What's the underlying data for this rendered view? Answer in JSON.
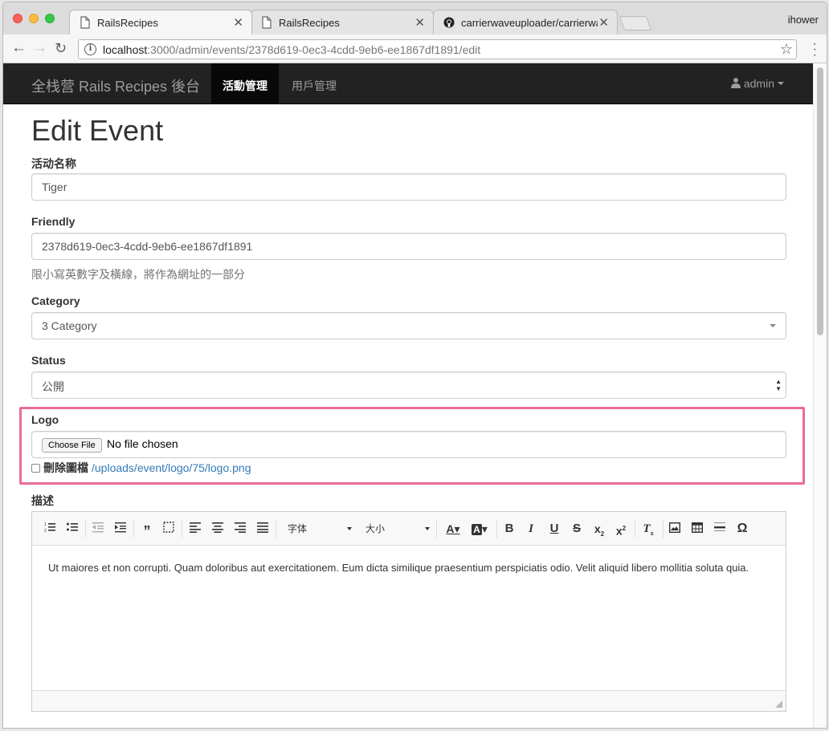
{
  "browser": {
    "tabs": [
      {
        "title": "RailsRecipes",
        "icon": "page-icon"
      },
      {
        "title": "RailsRecipes",
        "icon": "page-icon"
      },
      {
        "title": "carrierwaveuploader/carrierwa",
        "icon": "github-icon"
      }
    ],
    "profile": "ihower",
    "url_host": "localhost",
    "url_rest": ":3000/admin/events/2378d619-0ec3-4cdd-9eb6-ee1867df1891/edit"
  },
  "navbar": {
    "brand": "全栈营 Rails Recipes 後台",
    "items": [
      {
        "label": "活動管理",
        "active": true
      },
      {
        "label": "用戶管理",
        "active": false
      }
    ],
    "user": "admin"
  },
  "form": {
    "title": "Edit Event",
    "name_label": "活动名称",
    "name_value": "Tiger",
    "friendly_label": "Friendly",
    "friendly_value": "2378d619-0ec3-4cdd-9eb6-ee1867df1891",
    "friendly_help": "限小寫英數字及橫線，將作為網址的一部分",
    "category_label": "Category",
    "category_value": "3 Category",
    "status_label": "Status",
    "status_value": "公開",
    "logo_label": "Logo",
    "file_button": "Choose File",
    "file_status": "No file chosen",
    "remove_label": "刪除圖檔",
    "logo_path": "/uploads/event/logo/75/logo.png",
    "description_label": "描述"
  },
  "editor": {
    "font_combo": "字体",
    "size_combo": "大小",
    "body": "Ut maiores et non corrupti. Quam doloribus aut exercitationem. Eum dicta similique praesentium perspiciatis odio. Velit aliquid libero mollitia soluta quia."
  },
  "colors": {
    "navbar_bg": "#222222",
    "link": "#337ab7",
    "highlight_border": "#ec6a9b"
  }
}
